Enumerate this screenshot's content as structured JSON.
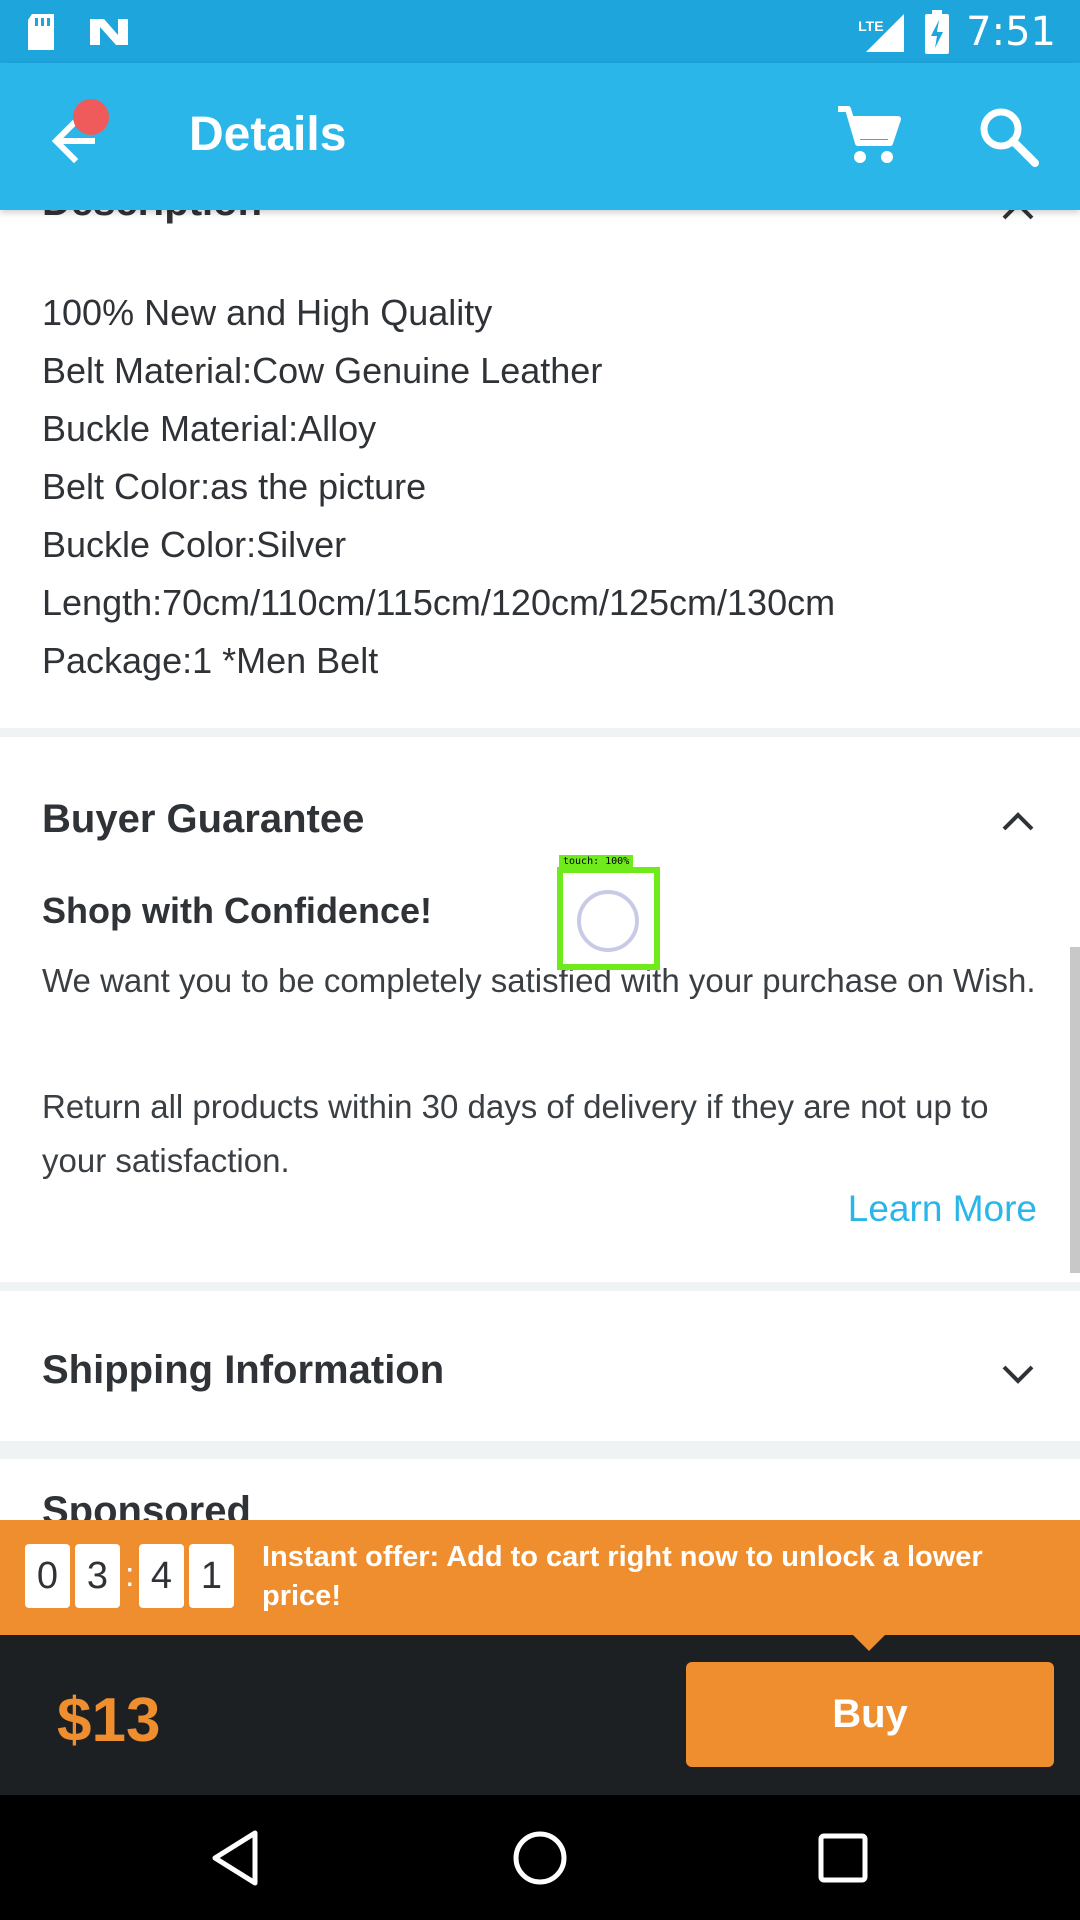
{
  "status_bar": {
    "time": "7:51",
    "network_label": "LTE",
    "icons": [
      "sd-card-icon",
      "n-logo-icon",
      "signal-icon",
      "battery-charging-icon"
    ]
  },
  "app_bar": {
    "title": "Details",
    "icons": [
      "back-arrow-icon",
      "cart-icon",
      "search-icon"
    ]
  },
  "description": {
    "title": "Description",
    "lines": [
      "100% New and High Quality",
      "Belt Material:Cow Genuine Leather",
      "Buckle Material:Alloy",
      "Belt Color:as the picture",
      "Buckle Color:Silver",
      "Length:70cm/110cm/115cm/120cm/125cm/130cm",
      "Package:1 *Men Belt"
    ]
  },
  "buyer_guarantee": {
    "title": "Buyer Guarantee",
    "subtitle": "Shop with Confidence!",
    "paragraph1": "We want you to be completely satisfied with your purchase on Wish.",
    "paragraph2": "Return all products within 30 days of delivery if they are not up to your satisfaction.",
    "learn_more": "Learn More"
  },
  "shipping": {
    "title": "Shipping Information"
  },
  "next_section": {
    "title": "Sponsored"
  },
  "touch_overlay": {
    "label": "touch: 100%"
  },
  "offer": {
    "timer_digits": [
      "0",
      "3",
      "4",
      "1"
    ],
    "separator": ":",
    "text": "Instant offer: Add to cart right now to unlock a lower price!"
  },
  "buy_bar": {
    "price": "$13",
    "buy_label": "Buy"
  },
  "nav_bar": {
    "icons": [
      "nav-back-icon",
      "nav-home-icon",
      "nav-recents-icon"
    ]
  },
  "colors": {
    "status_bar": "#1ea5db",
    "app_bar": "#2ab6e8",
    "accent_orange": "#ef8e2f",
    "link_blue": "#2ab6e8",
    "buy_bar_bg": "#1d2023",
    "notification_dot": "#ef5b5b",
    "touch_indicator": "#6fea1b"
  }
}
